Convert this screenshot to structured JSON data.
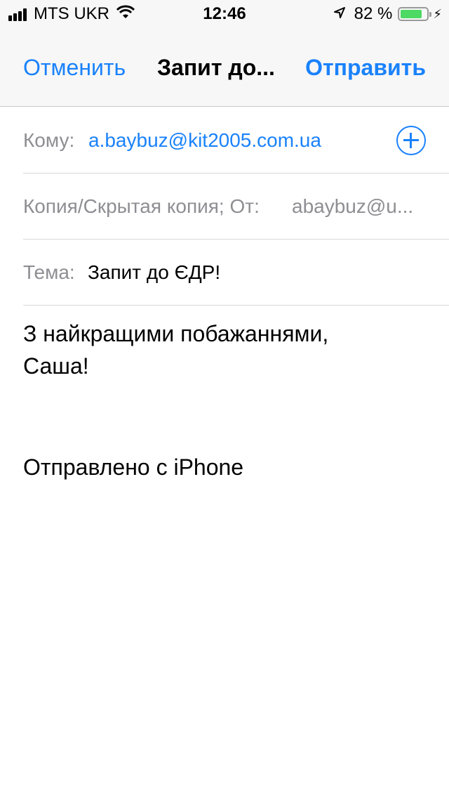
{
  "status_bar": {
    "carrier": "MTS UKR",
    "time": "12:46",
    "battery_percent": "82 %",
    "battery_level": 0.82,
    "battery_color": "#4cd964"
  },
  "nav": {
    "cancel_label": "Отменить",
    "title": "Запит до...",
    "send_label": "Отправить"
  },
  "compose": {
    "to_label": "Кому:",
    "to_value": "a.baybuz@kit2005.com.ua",
    "add_icon": "plus-circle-icon",
    "cc_label": "Копия/Скрытая копия; От:",
    "from_value": "abaybuz@u...",
    "subject_label": "Тема:",
    "subject_value": "Запит до ЄДР!",
    "body_line1": "З найкращими побажаннями,",
    "body_line2": "Саша!",
    "signature": "Отправлено с iPhone"
  },
  "colors": {
    "accent": "#1a82fb",
    "secondary_text": "#8e8e93"
  }
}
